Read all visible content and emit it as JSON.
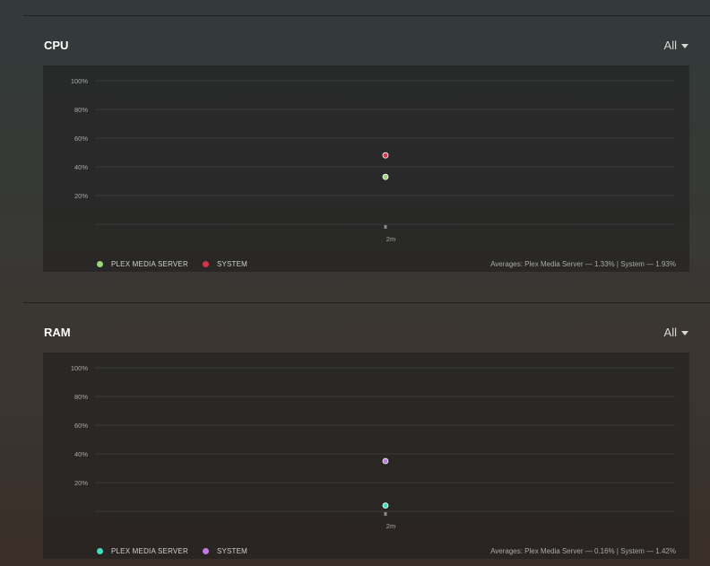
{
  "sections": [
    {
      "title": "CPU",
      "filter": "All",
      "legend": [
        {
          "label": "PLEX MEDIA SERVER",
          "color": "#98d57b"
        },
        {
          "label": "SYSTEM",
          "color": "#d4344c"
        }
      ],
      "averages": "Averages: Plex Media Server — 1.33% | System — 1.93%"
    },
    {
      "title": "RAM",
      "filter": "All",
      "legend": [
        {
          "label": "PLEX MEDIA SERVER",
          "color": "#3fe0b9"
        },
        {
          "label": "SYSTEM",
          "color": "#c07be0"
        }
      ],
      "averages": "Averages: Plex Media Server — 0.16% | System — 1.42%"
    }
  ],
  "chart_data": [
    {
      "type": "scatter",
      "title": "CPU",
      "y_ticks": [
        "100%",
        "80%",
        "60%",
        "40%",
        "20%"
      ],
      "x_tick": "2m",
      "ylim": [
        0,
        100
      ],
      "grid": true,
      "legend_position": "bottom-left",
      "series": [
        {
          "name": "PLEX MEDIA SERVER",
          "x": [
            "2m"
          ],
          "values": [
            33
          ],
          "color": "#98d57b"
        },
        {
          "name": "SYSTEM",
          "x": [
            "2m"
          ],
          "values": [
            48
          ],
          "color": "#d4344c"
        }
      ]
    },
    {
      "type": "scatter",
      "title": "RAM",
      "y_ticks": [
        "100%",
        "80%",
        "60%",
        "40%",
        "20%"
      ],
      "x_tick": "2m",
      "ylim": [
        0,
        100
      ],
      "grid": true,
      "legend_position": "bottom-left",
      "series": [
        {
          "name": "PLEX MEDIA SERVER",
          "x": [
            "2m"
          ],
          "values": [
            4
          ],
          "color": "#3fe0b9"
        },
        {
          "name": "SYSTEM",
          "x": [
            "2m"
          ],
          "values": [
            35
          ],
          "color": "#c07be0"
        }
      ]
    }
  ]
}
